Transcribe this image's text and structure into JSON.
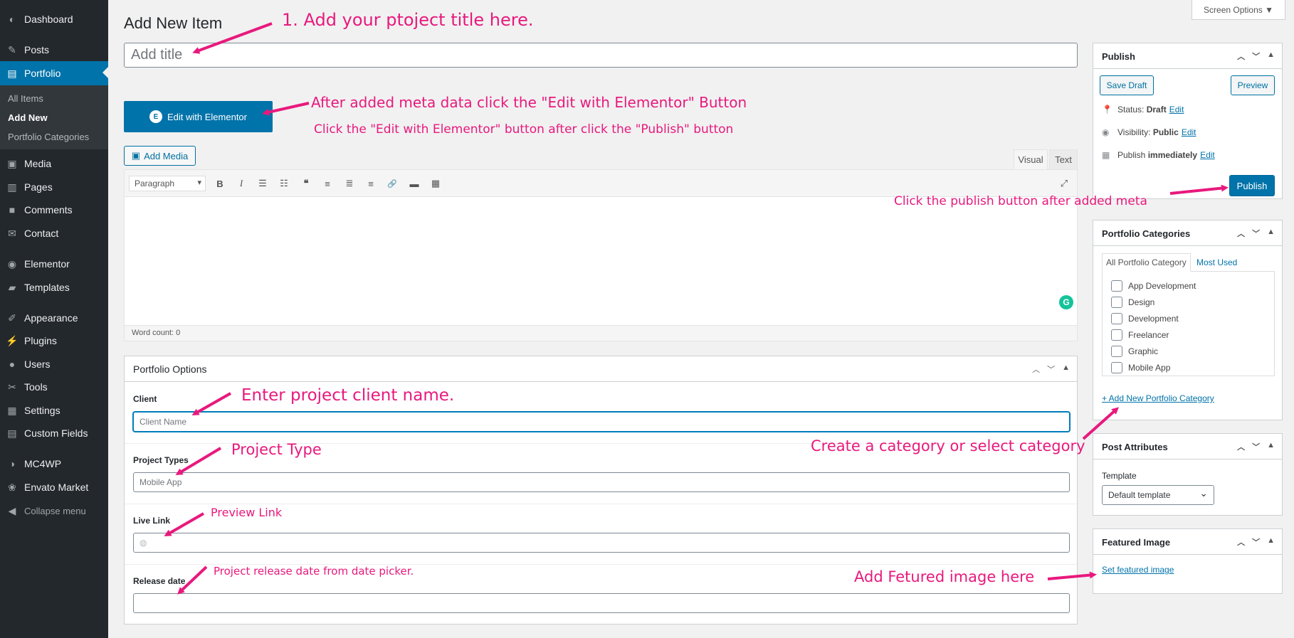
{
  "sidebar": {
    "items": [
      {
        "label": "Dashboard",
        "icon": "dashboard-icon",
        "glyph": "◐"
      },
      {
        "label": "Posts",
        "icon": "pin-icon",
        "glyph": "✎"
      },
      {
        "label": "Portfolio",
        "icon": "portfolio-icon",
        "glyph": "▤"
      },
      {
        "label": "Media",
        "icon": "media-icon",
        "glyph": "▣"
      },
      {
        "label": "Pages",
        "icon": "pages-icon",
        "glyph": "▥"
      },
      {
        "label": "Comments",
        "icon": "comments-icon",
        "glyph": "■"
      },
      {
        "label": "Contact",
        "icon": "mail-icon",
        "glyph": "✉"
      },
      {
        "label": "Elementor",
        "icon": "elementor-icon",
        "glyph": "◉"
      },
      {
        "label": "Templates",
        "icon": "folder-icon",
        "glyph": "▰"
      },
      {
        "label": "Appearance",
        "icon": "brush-icon",
        "glyph": "✐"
      },
      {
        "label": "Plugins",
        "icon": "plugin-icon",
        "glyph": "⚡"
      },
      {
        "label": "Users",
        "icon": "user-icon",
        "glyph": "●"
      },
      {
        "label": "Tools",
        "icon": "wrench-icon",
        "glyph": "✂"
      },
      {
        "label": "Settings",
        "icon": "settings-icon",
        "glyph": "▦"
      },
      {
        "label": "Custom Fields",
        "icon": "fields-icon",
        "glyph": "▤"
      },
      {
        "label": "MC4WP",
        "icon": "mc4wp-icon",
        "glyph": "◑"
      },
      {
        "label": "Envato Market",
        "icon": "envato-icon",
        "glyph": "❀"
      },
      {
        "label": "Collapse menu",
        "icon": "collapse-icon",
        "glyph": "◀"
      }
    ],
    "submenu": [
      "All Items",
      "Add New",
      "Portfolio Categories"
    ]
  },
  "page": {
    "heading": "Add New Item",
    "screen_options": "Screen Options ▼",
    "title_placeholder": "Add title"
  },
  "editor": {
    "elementor_button": "Edit with Elementor",
    "add_media": "Add Media",
    "tab_visual": "Visual",
    "tab_text": "Text",
    "format": "Paragraph",
    "word_count": "Word count: 0",
    "toolbar_glyphs": [
      "B",
      "I",
      "☰",
      "☷",
      "❝",
      "≡",
      "≣",
      "≡",
      "🔗",
      "▬",
      "▦"
    ]
  },
  "portfolio_options": {
    "title": "Portfolio Options",
    "client_label": "Client",
    "client_placeholder": "Client Name",
    "project_types_label": "Project Types",
    "project_types_placeholder": "Mobile App",
    "live_link_label": "Live Link",
    "release_date_label": "Release date"
  },
  "publish": {
    "title": "Publish",
    "save_draft": "Save Draft",
    "preview": "Preview",
    "status_label": "Status:",
    "status_value": "Draft",
    "visibility_label": "Visibility:",
    "visibility_value": "Public",
    "publish_label": "Publish",
    "publish_value": "immediately",
    "edit": "Edit",
    "publish_button": "Publish"
  },
  "categories": {
    "title": "Portfolio Categories",
    "tab_all": "All Portfolio Category",
    "tab_most": "Most Used",
    "items": [
      "App Development",
      "Design",
      "Development",
      "Freelancer",
      "Graphic",
      "Mobile App"
    ],
    "add_new": "+ Add New Portfolio Category"
  },
  "post_attributes": {
    "title": "Post Attributes",
    "template_label": "Template",
    "template_value": "Default template"
  },
  "featured_image": {
    "title": "Featured Image",
    "set_link": "Set featured image"
  },
  "annotations": {
    "title": "1. Add your ptoject title here.",
    "elementor1": "After added meta data click the \"Edit with Elementor\" Button",
    "elementor2": "Click the \"Edit with Elementor\" button after click the \"Publish\" button",
    "publish": "Click the publish button after added meta",
    "client": "Enter project client name.",
    "project_type": "Project Type",
    "preview_link": "Preview Link",
    "release_date": "Project release date from date picker.",
    "category": "Create a category or select category",
    "featured": "Add Fetured image here"
  },
  "colors": {
    "accent": "#0073aa",
    "annotation": "#e8197d",
    "sidebar": "#23282d"
  }
}
